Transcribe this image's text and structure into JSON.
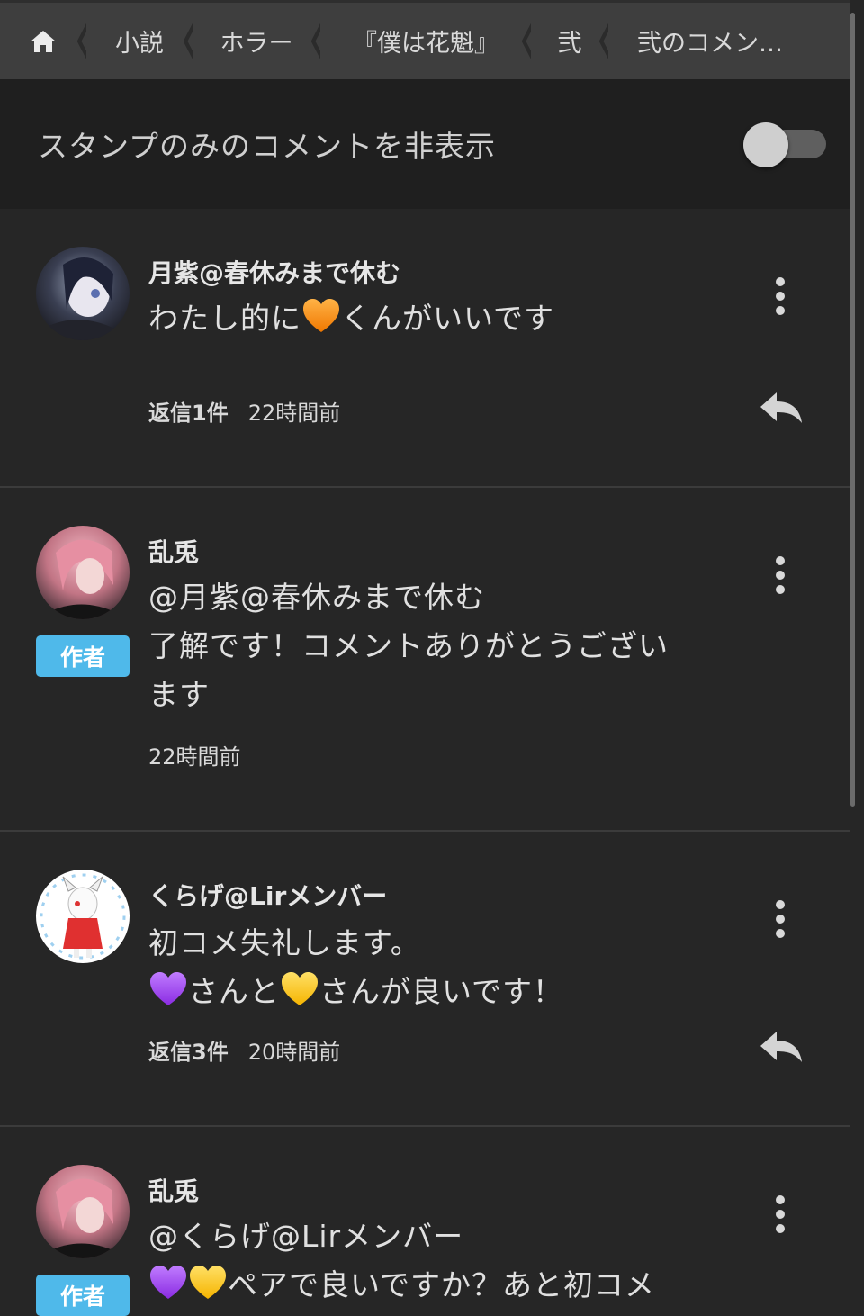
{
  "breadcrumb": {
    "items": [
      "小説",
      "ホラー",
      "『僕は花魁』",
      "弐",
      "弐のコメン…"
    ]
  },
  "filter": {
    "label": "スタンプのみのコメントを非表示",
    "toggle_on": false
  },
  "colors": {
    "background": "#262626",
    "author_badge": "#4fb9ea",
    "breadcrumb_bg": "#3e3e3e"
  },
  "comments": [
    {
      "name": "月紫@春休みまで休む",
      "text_a": "わたし的に",
      "emoji_a": "orange-heart",
      "text_b": "くんがいいです",
      "replies": "返信1件",
      "time": "22時間前"
    },
    {
      "name": "乱兎",
      "badge": "作者",
      "line1": "@月紫@春休みまで休む",
      "line2": "了解です！コメントありがとうござい",
      "line3": "ます",
      "time": "22時間前"
    },
    {
      "name": "くらげ@Lirメンバー",
      "line1": "初コメ失礼します。",
      "line2_a": "さんと",
      "line2_b": "さんが良いです！",
      "replies": "返信3件",
      "time": "20時間前"
    },
    {
      "name": "乱兎",
      "badge": "作者",
      "line1": "@くらげ@Lirメンバー",
      "line2": "ペアで良いですか？あと初コメ"
    }
  ],
  "icons": {
    "home": "home-icon",
    "more": "more-vertical-icon",
    "reply": "reply-icon"
  }
}
